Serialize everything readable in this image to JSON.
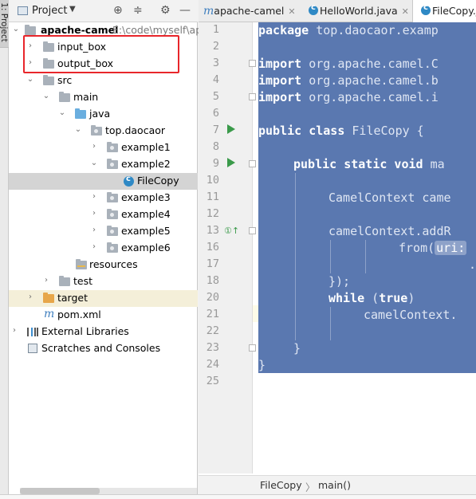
{
  "tool_window": {
    "stripe_label": "1: Project",
    "title": "Project"
  },
  "tree": {
    "root": {
      "name": "apache-camel",
      "path": "E:\\code\\myself\\ap"
    },
    "items": [
      {
        "label": "input_box"
      },
      {
        "label": "output_box"
      },
      {
        "label": "src"
      },
      {
        "label": "main"
      },
      {
        "label": "java"
      },
      {
        "label": "top.daocaor"
      },
      {
        "label": "example1"
      },
      {
        "label": "example2"
      },
      {
        "label": "FileCopy"
      },
      {
        "label": "example3"
      },
      {
        "label": "example4"
      },
      {
        "label": "example5"
      },
      {
        "label": "example6"
      },
      {
        "label": "resources"
      },
      {
        "label": "test"
      },
      {
        "label": "target"
      },
      {
        "label": "pom.xml"
      },
      {
        "label": "External Libraries"
      },
      {
        "label": "Scratches and Consoles"
      }
    ]
  },
  "tabs": [
    {
      "label": "apache-camel"
    },
    {
      "label": "HelloWorld.java"
    },
    {
      "label": "FileCopy.j"
    }
  ],
  "line_numbers": [
    "1",
    "2",
    "3",
    "4",
    "5",
    "6",
    "7",
    "8",
    "9",
    "10",
    "11",
    "12",
    "13",
    "16",
    "17",
    "18",
    "20",
    "21",
    "22",
    "23",
    "24",
    "25"
  ],
  "code": {
    "l1": {
      "kw": "package",
      "rest": " top.daocaor.examp"
    },
    "l3": {
      "kw": "import",
      "rest": " org.apache.camel.C"
    },
    "l4": {
      "kw": "import",
      "rest": " org.apache.camel.b"
    },
    "l5": {
      "kw": "import",
      "rest": " org.apache.camel.i"
    },
    "l7": {
      "kw": "public class",
      "rest": " FileCopy {"
    },
    "l9": {
      "kw": "public static void",
      "rest": " ma"
    },
    "l11": {
      "rest": "CamelContext came"
    },
    "l13": {
      "rest": "camelContext.addR"
    },
    "l16": {
      "pre": "from(",
      "uri": "uri:",
      "post": " "
    },
    "l17": {
      "rest": "."
    },
    "l18": {
      "rest": "});"
    },
    "l20": {
      "kw": "while",
      "rest": " (",
      "kw2": "true",
      "post": ")"
    },
    "l21": {
      "rest": "camelContext."
    },
    "l23": {
      "rest": "}"
    },
    "l24": {
      "rest": "}"
    }
  },
  "breadcrumb": {
    "file": "FileCopy",
    "method": "main()"
  },
  "colors": {
    "selection": "#5a78b0",
    "highlight_box": "#e8262b"
  }
}
